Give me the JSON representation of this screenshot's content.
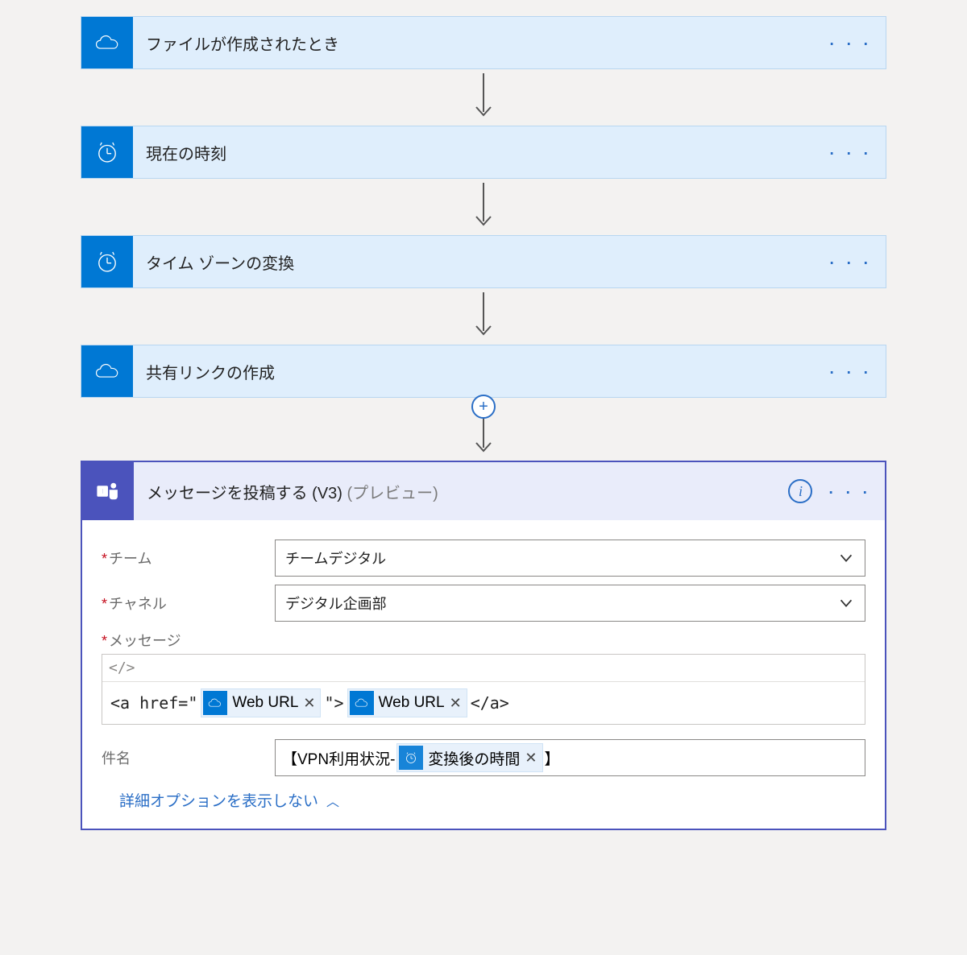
{
  "steps": [
    {
      "title": "ファイルが作成されたとき",
      "icon": "onedrive"
    },
    {
      "title": "現在の時刻",
      "icon": "schedule"
    },
    {
      "title": "タイム ゾーンの変換",
      "icon": "schedule"
    },
    {
      "title": "共有リンクの作成",
      "icon": "onedrive"
    }
  ],
  "teams_step": {
    "title": "メッセージを投稿する (V3)",
    "suffix": "(プレビュー)"
  },
  "form": {
    "team_label": "チーム",
    "team_value": "チームデジタル",
    "channel_label": "チャネル",
    "channel_value": "デジタル企画部",
    "message_label": "メッセージ",
    "message_parts": {
      "prefix": "<a href=\"",
      "token1": "Web URL",
      "middle": "\">",
      "token2": "Web URL",
      "suffix": "</a>"
    },
    "subject_label": "件名",
    "subject_parts": {
      "prefix": "【VPN利用状況-",
      "token": "変換後の時間",
      "suffix": "】"
    },
    "hide_options": "詳細オプションを表示しない"
  }
}
